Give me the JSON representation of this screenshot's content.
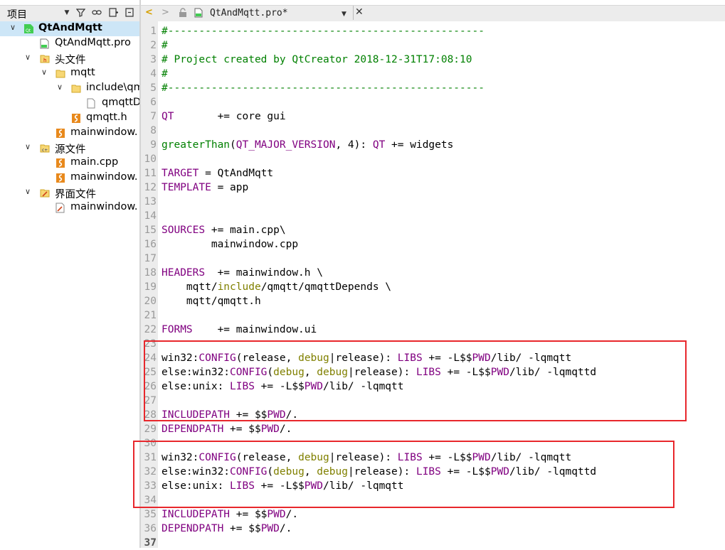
{
  "panel": {
    "title": "项目",
    "tree": [
      {
        "label": "QtAndMqtt",
        "level": 0,
        "expanded": true,
        "icon": "qt-project-icon",
        "bold": true,
        "selected": true
      },
      {
        "label": "QtAndMqtt.pro",
        "level": 1,
        "icon": "pro-file-icon"
      },
      {
        "label": "头文件",
        "level": 1,
        "expanded": true,
        "icon": "header-folder-icon"
      },
      {
        "label": "mqtt",
        "level": 2,
        "expanded": true,
        "icon": "folder-icon"
      },
      {
        "label": "include\\qm",
        "level": 3,
        "expanded": true,
        "icon": "folder-icon"
      },
      {
        "label": "qmqttD",
        "level": 4,
        "icon": "file-icon"
      },
      {
        "label": "qmqtt.h",
        "level": 3,
        "icon": "h-file-icon"
      },
      {
        "label": "mainwindow.",
        "level": 2,
        "icon": "h-file-icon"
      },
      {
        "label": "源文件",
        "level": 1,
        "expanded": true,
        "icon": "source-folder-icon"
      },
      {
        "label": "main.cpp",
        "level": 2,
        "icon": "cpp-file-icon"
      },
      {
        "label": "mainwindow.",
        "level": 2,
        "icon": "cpp-file-icon"
      },
      {
        "label": "界面文件",
        "level": 1,
        "expanded": true,
        "icon": "form-folder-icon"
      },
      {
        "label": "mainwindow.",
        "level": 2,
        "icon": "ui-file-icon"
      }
    ]
  },
  "editor": {
    "file_tab": "QtAndMqtt.pro*",
    "current_line": 37,
    "lines": [
      [
        [
          "#---------------------------------------------------",
          "comment"
        ]
      ],
      [
        [
          "#",
          "comment"
        ]
      ],
      [
        [
          "# Project created by QtCreator 2018-12-31T17:08:10",
          "comment"
        ]
      ],
      [
        [
          "#",
          "comment"
        ]
      ],
      [
        [
          "#---------------------------------------------------",
          "comment"
        ]
      ],
      [],
      [
        [
          "QT",
          "kw"
        ],
        [
          "       += core gui",
          ""
        ]
      ],
      [],
      [
        [
          "greaterThan",
          "fn"
        ],
        [
          "(",
          ""
        ],
        [
          "QT_MAJOR_VERSION",
          "kw"
        ],
        [
          ", 4): ",
          ""
        ],
        [
          "QT",
          "kw"
        ],
        [
          " += widgets",
          ""
        ]
      ],
      [],
      [
        [
          "TARGET",
          "kw"
        ],
        [
          " = QtAndMqtt",
          ""
        ]
      ],
      [
        [
          "TEMPLATE",
          "kw"
        ],
        [
          " = app",
          ""
        ]
      ],
      [],
      [],
      [
        [
          "SOURCES",
          "kw"
        ],
        [
          " += main.cpp\\",
          ""
        ]
      ],
      [
        [
          "        mainwindow.cpp",
          ""
        ]
      ],
      [],
      [
        [
          "HEADERS",
          "kw"
        ],
        [
          "  += mainwindow.h \\",
          ""
        ]
      ],
      [
        [
          "    mqtt/",
          ""
        ],
        [
          "include",
          "olive"
        ],
        [
          "/qmqtt/qmqttDepends \\",
          ""
        ]
      ],
      [
        [
          "    mqtt/qmqtt.h",
          ""
        ]
      ],
      [],
      [
        [
          "FORMS",
          "kw"
        ],
        [
          "    += mainwindow.ui",
          ""
        ]
      ],
      [],
      [
        [
          "win32:",
          ""
        ],
        [
          "CONFIG",
          "kw"
        ],
        [
          "(release, ",
          ""
        ],
        [
          "debug",
          "olive"
        ],
        [
          "|release): ",
          ""
        ],
        [
          "LIBS",
          "kw"
        ],
        [
          " += -L$$",
          ""
        ],
        [
          "PWD",
          "kw"
        ],
        [
          "/lib/ -lqmqtt",
          ""
        ]
      ],
      [
        [
          "else:win32:",
          ""
        ],
        [
          "CONFIG",
          "kw"
        ],
        [
          "(",
          ""
        ],
        [
          "debug",
          "olive"
        ],
        [
          ", ",
          ""
        ],
        [
          "debug",
          "olive"
        ],
        [
          "|release): ",
          ""
        ],
        [
          "LIBS",
          "kw"
        ],
        [
          " += -L$$",
          ""
        ],
        [
          "PWD",
          "kw"
        ],
        [
          "/lib/ -lqmqttd",
          ""
        ]
      ],
      [
        [
          "else:unix: ",
          ""
        ],
        [
          "LIBS",
          "kw"
        ],
        [
          " += -L$$",
          ""
        ],
        [
          "PWD",
          "kw"
        ],
        [
          "/lib/ -lqmqtt",
          ""
        ]
      ],
      [],
      [
        [
          "INCLUDEPATH",
          "kw"
        ],
        [
          " += $$",
          ""
        ],
        [
          "PWD",
          "kw"
        ],
        [
          "/.",
          ""
        ]
      ],
      [
        [
          "DEPENDPATH",
          "kw"
        ],
        [
          " += $$",
          ""
        ],
        [
          "PWD",
          "kw"
        ],
        [
          "/.",
          ""
        ]
      ],
      [],
      [
        [
          "win32:",
          ""
        ],
        [
          "CONFIG",
          "kw"
        ],
        [
          "(release, ",
          ""
        ],
        [
          "debug",
          "olive"
        ],
        [
          "|release): ",
          ""
        ],
        [
          "LIBS",
          "kw"
        ],
        [
          " += -L$$",
          ""
        ],
        [
          "PWD",
          "kw"
        ],
        [
          "/lib/ -lqmqtt",
          ""
        ]
      ],
      [
        [
          "else:win32:",
          ""
        ],
        [
          "CONFIG",
          "kw"
        ],
        [
          "(",
          ""
        ],
        [
          "debug",
          "olive"
        ],
        [
          ", ",
          ""
        ],
        [
          "debug",
          "olive"
        ],
        [
          "|release): ",
          ""
        ],
        [
          "LIBS",
          "kw"
        ],
        [
          " += -L$$",
          ""
        ],
        [
          "PWD",
          "kw"
        ],
        [
          "/lib/ -lqmqttd",
          ""
        ]
      ],
      [
        [
          "else:unix: ",
          ""
        ],
        [
          "LIBS",
          "kw"
        ],
        [
          " += -L$$",
          ""
        ],
        [
          "PWD",
          "kw"
        ],
        [
          "/lib/ -lqmqtt",
          ""
        ]
      ],
      [],
      [
        [
          "INCLUDEPATH",
          "kw"
        ],
        [
          " += $$",
          ""
        ],
        [
          "PWD",
          "kw"
        ],
        [
          "/.",
          ""
        ]
      ],
      [
        [
          "DEPENDPATH",
          "kw"
        ],
        [
          " += $$",
          ""
        ],
        [
          "PWD",
          "kw"
        ],
        [
          "/.",
          ""
        ]
      ],
      []
    ]
  },
  "colors": {
    "comment": "#008000",
    "keyword": "#800080",
    "function": "#008000",
    "olive": "#808000",
    "highlight_box": "#e8272c",
    "selection": "#cde6f7"
  }
}
